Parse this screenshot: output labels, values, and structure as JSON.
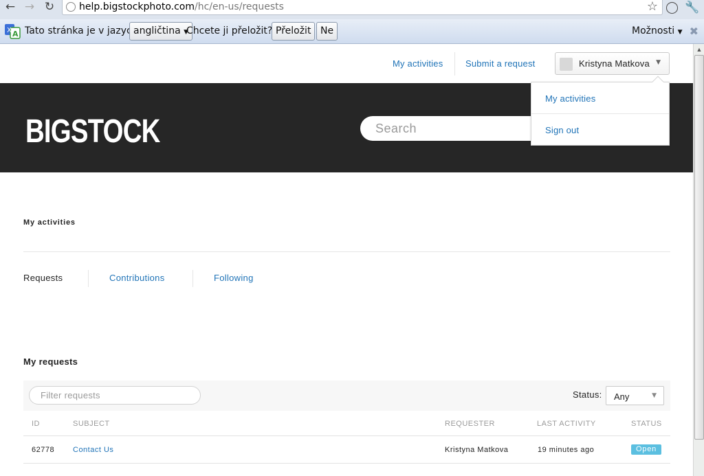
{
  "browser": {
    "url_host": "help.bigstockphoto.com",
    "url_path": "/hc/en-us/requests",
    "translate_bar": {
      "prefix": "Tato stránka je v jazyce",
      "language": "angličtina",
      "question": "Chcete ji přeložit?",
      "translate_button": "Přeložit",
      "no_button": "Ne",
      "options": "Možnosti"
    }
  },
  "header": {
    "my_activities_link": "My activities",
    "submit_request_link": "Submit a request",
    "user_name": "Kristyna Matkova",
    "user_menu": {
      "items": [
        "My activities",
        "Sign out"
      ]
    }
  },
  "hero": {
    "logo_text": "BIGSTOCK",
    "search_placeholder": "Search"
  },
  "main": {
    "title": "My activities",
    "tabs": [
      {
        "label": "Requests",
        "active": true
      },
      {
        "label": "Contributions",
        "active": false
      },
      {
        "label": "Following",
        "active": false
      }
    ],
    "section_title": "My requests",
    "filter_placeholder": "Filter requests",
    "status_label": "Status:",
    "status_value": "Any",
    "table": {
      "columns": [
        "ID",
        "SUBJECT",
        "REQUESTER",
        "LAST ACTIVITY",
        "STATUS"
      ],
      "rows": [
        {
          "id": "62778",
          "subject": "Contact Us",
          "requester": "Kristyna Matkova",
          "last_activity": "19 minutes ago",
          "status": "Open"
        }
      ]
    }
  },
  "colors": {
    "link": "#1f73b7",
    "hero_bg": "#262626",
    "badge_open": "#5bbfe0"
  }
}
